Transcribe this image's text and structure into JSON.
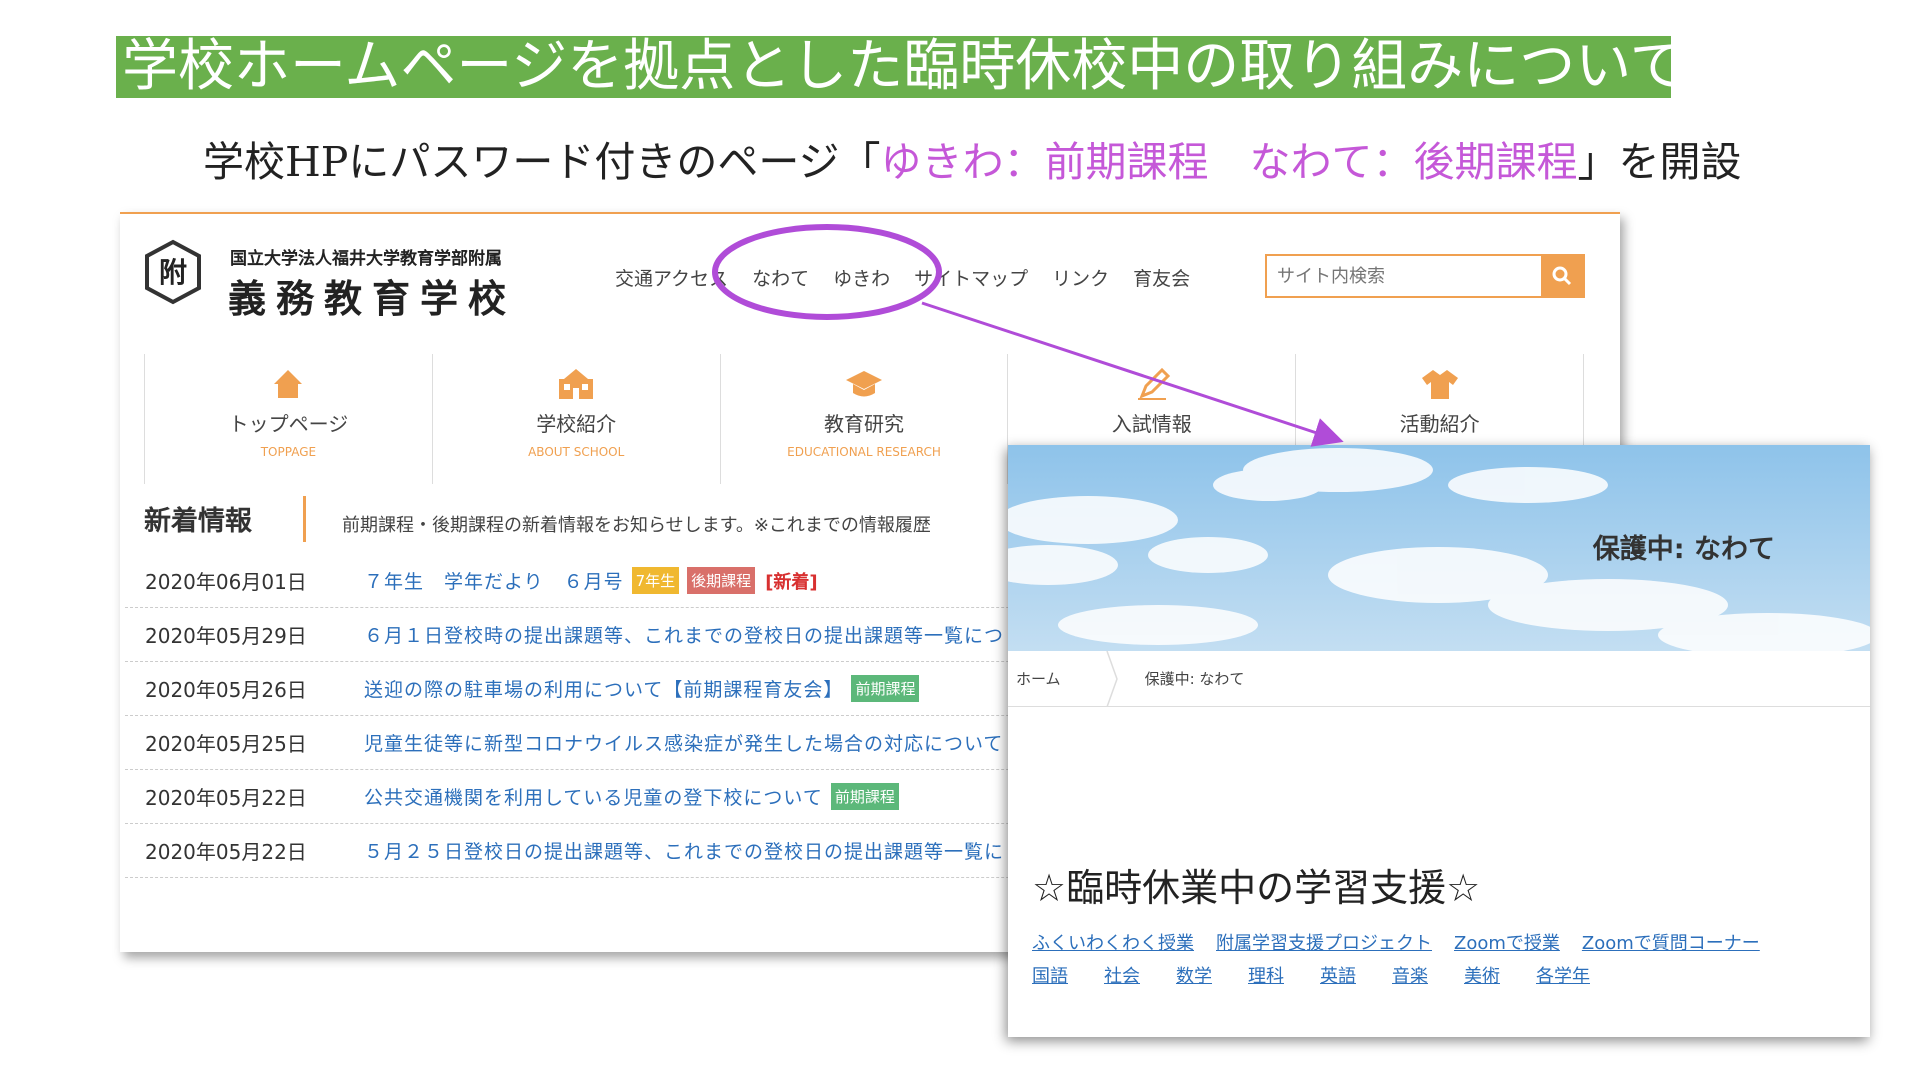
{
  "slide": {
    "title": "学校ホームページを拠点とした臨時休校中の取り組みについて",
    "subtitle_pre": "学校HPにパスワード付きのページ「",
    "subtitle_highlight": "ゆきわ：前期課程　なわて：後期課程",
    "subtitle_post": "」を開設"
  },
  "site": {
    "logo_mark": "附",
    "logo_small": "国立大学法人福井大学教育学部附属",
    "logo_big": "義務教育学校",
    "nav": [
      "交通アクセス",
      "なわて",
      "ゆきわ",
      "サイトマップ",
      "リンク",
      "育友会"
    ],
    "search_placeholder": "サイト内検索",
    "menu": [
      {
        "label": "トップページ",
        "sub": "TOPPAGE",
        "icon": "home-icon"
      },
      {
        "label": "学校紹介",
        "sub": "ABOUT SCHOOL",
        "icon": "school-icon"
      },
      {
        "label": "教育研究",
        "sub": "EDUCATIONAL RESEARCH",
        "icon": "graduation-cap-icon"
      },
      {
        "label": "入試情報",
        "sub": "",
        "icon": "pencil-icon"
      },
      {
        "label": "活動紹介",
        "sub": "",
        "icon": "shirt-icon"
      }
    ],
    "news_heading": "新着情報",
    "news_desc": "前期課程・後期課程の新着情報をお知らせします。※これまでの情報履歴",
    "news": [
      {
        "date": "2020年06月01日",
        "title": "７年生　学年だより　６月号",
        "badges": [
          "7年生",
          "後期課程"
        ],
        "new": "[新着]"
      },
      {
        "date": "2020年05月29日",
        "title": "６月１日登校時の提出課題等、これまでの登校日の提出課題等一覧につ",
        "badges": [],
        "new": ""
      },
      {
        "date": "2020年05月26日",
        "title": "送迎の際の駐車場の利用について【前期課程育友会】",
        "badges": [
          "前期課程"
        ],
        "new": ""
      },
      {
        "date": "2020年05月25日",
        "title": "児童生徒等に新型コロナウイルス感染症が発生した場合の対応について",
        "badges": [],
        "new": ""
      },
      {
        "date": "2020年05月22日",
        "title": "公共交通機関を利用している児童の登下校について",
        "badges": [
          "前期課程"
        ],
        "new": ""
      },
      {
        "date": "2020年05月22日",
        "title": "５月２５日登校日の提出課題等、これまでの登校日の提出課題等一覧に",
        "badges": [],
        "new": ""
      }
    ]
  },
  "protected": {
    "title": "保護中: なわて",
    "breadcrumb_home": "ホーム",
    "breadcrumb_current": "保護中: なわて",
    "heading": "☆臨時休業中の学習支援☆",
    "links_row1": [
      "ふくいわくわく授業",
      "附属学習支援プロジェクト",
      "Zoomで授業",
      "Zoomで質問コーナー"
    ],
    "links_row2": [
      "国語",
      "社会",
      "数学",
      "理科",
      "英語",
      "音楽",
      "美術",
      "各学年"
    ]
  },
  "colors": {
    "title_bg": "#6ab04c",
    "highlight": "#c558d8",
    "accent": "#f0a050",
    "link": "#2c6fbb",
    "badge_grade": "#f0b830",
    "badge_late": "#d9706a",
    "badge_early": "#5cb87a"
  }
}
